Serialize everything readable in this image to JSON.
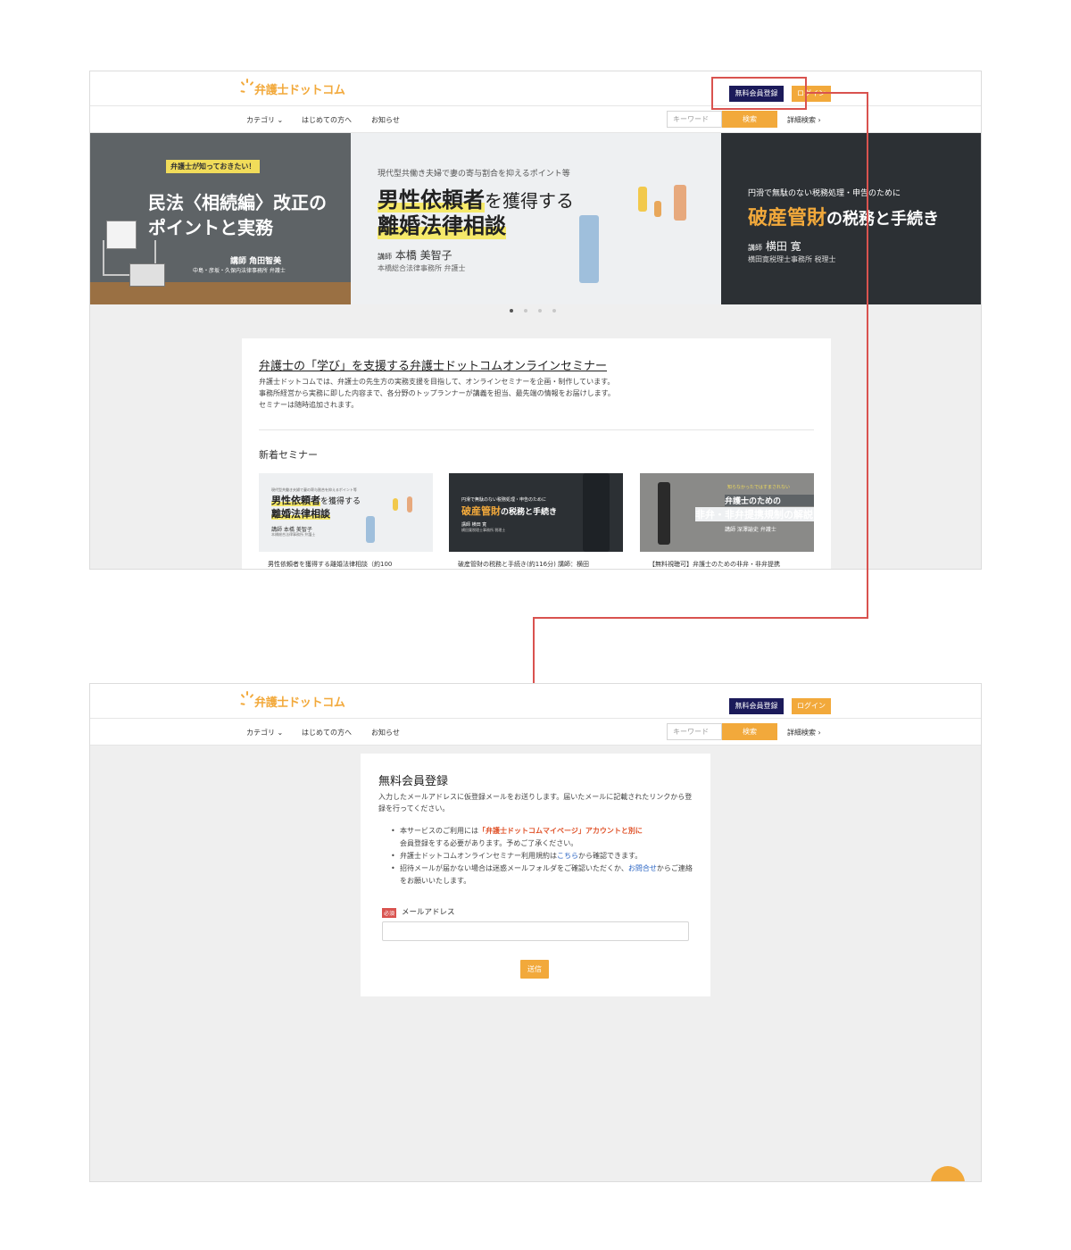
{
  "header": {
    "logo": "弁護士ドットコム",
    "register_button": "無料会員登録",
    "login_button": "ログイン"
  },
  "nav": {
    "category": "カテゴリ ⌄",
    "first_time": "はじめての方へ",
    "news": "お知らせ",
    "search_placeholder": "キーワード",
    "search_button": "検索",
    "advanced_search": "詳細検索 ›"
  },
  "banners": [
    {
      "tag": "弁護士が知っておきたい！",
      "title_line1": "民法〈相続編〉改正の",
      "title_line2": "ポイントと実務",
      "lecturer": "講師 角田智美",
      "office": "中島・彦坂・久保内法律事務所 弁護士"
    },
    {
      "subtitle": "現代型共働き夫婦で妻の寄与割合を抑えるポイント等",
      "title_line1_highlight": "男性依頼者",
      "title_line1_rest": "を獲得する",
      "title_line2": "離婚法律相談",
      "lecturer_label": "講師",
      "lecturer_name": "本橋 美智子",
      "office": "本橋総合法律事務所 弁護士"
    },
    {
      "subtitle": "円滑で無駄のない税務処理・申告のために",
      "title_highlight": "破産管財",
      "title_rest": "の税務と手続き",
      "lecturer_label": "講師",
      "lecturer_name": "横田 寛",
      "office": "横田寛税理士事務所 税理士"
    }
  ],
  "intro": {
    "title": "弁護士の「学び」を支援する弁護士ドットコムオンラインセミナー",
    "line1": "弁護士ドットコムでは、弁護士の先生方の実務支援を目指して、オンラインセミナーを企画・制作しています。",
    "line2": "事務所経営から実務に即した内容まで、各分野のトップランナーが講義を担当、最先端の情報をお届けします。",
    "line3": "セミナーは随時追加されます。",
    "new_heading": "新着セミナー"
  },
  "seminars": [
    {
      "thumb_sub": "現代型共働き夫婦で妻の寄与割合を抑えるポイント等",
      "thumb_hl": "男性依頼者",
      "thumb_rest": "を獲得する",
      "thumb_line2": "離婚法律相談",
      "thumb_lecturer": "講師 本橋 美智子",
      "thumb_office": "本橋総合法律事務所 弁護士",
      "caption": "男性依頼者を獲得する離婚法律相談（約100"
    },
    {
      "thumb_sub": "円滑で無駄のない税務処理・申告のために",
      "thumb_hl": "破産管財",
      "thumb_rest": "の税務と手続き",
      "thumb_lecturer": "講師 横田 寛",
      "thumb_office": "横田寛税理士事務所 税理士",
      "caption": "破産管財の税務と手続き(約116分) 講師：横田"
    },
    {
      "thumb_sub": "知らなかったではすまされない",
      "thumb_line1": "弁護士のための",
      "thumb_line2": "非弁・非弁提携規制の解説",
      "thumb_lecturer": "講師 深澤諭史 弁護士",
      "caption": "【無料視聴可】弁護士のための非弁・非弁提携"
    }
  ],
  "register_form": {
    "title": "無料会員登録",
    "intro": "入力したメールアドレスに仮登録メールをお送りします。届いたメールに記載されたリンクから登録を行ってください。",
    "bullet1_pre": "本サービスのご利用には",
    "bullet1_em": "「弁護士ドットコムマイページ」アカウントと別に",
    "bullet1_post": "会員登録をする必要があります。予めご了承ください。",
    "bullet2_pre": "弁護士ドットコムオンラインセミナー利用規約は",
    "bullet2_link": "こちら",
    "bullet2_post": "から確認できます。",
    "bullet3_pre": "招待メールが届かない場合は迷惑メールフォルダをご確認いただくか、",
    "bullet3_link": "お問合せ",
    "bullet3_post": "からご連絡をお願いいたします。",
    "required_badge": "必須",
    "email_label": "メールアドレス",
    "submit": "送信"
  },
  "colors": {
    "brand_orange": "#f2a93b",
    "navy": "#1b1a5a",
    "annotation_red": "#d9534f"
  }
}
